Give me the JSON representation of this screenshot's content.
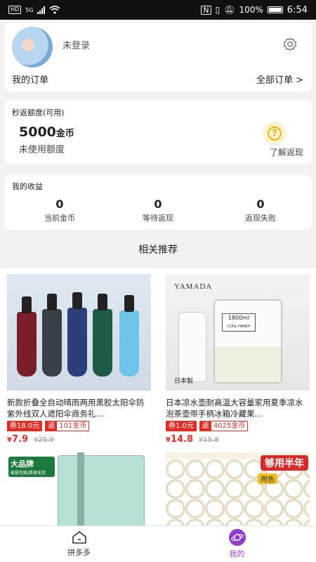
{
  "status_bar": {
    "network": "5G",
    "battery": "100%",
    "time": "6:54",
    "hd": "HD"
  },
  "profile": {
    "login_status": "未登录",
    "orders_label": "我的订单",
    "all_orders": "全部订单 >"
  },
  "quota": {
    "title": "秒返额度(可用)",
    "amount": "5000",
    "unit": "金币",
    "subtitle": "未使用额度",
    "help_label": "了解返现",
    "help_glyph": "?"
  },
  "earnings": {
    "title": "我的收益",
    "stats": [
      {
        "value": "0",
        "label": "当前金币"
      },
      {
        "value": "0",
        "label": "等待返现"
      },
      {
        "value": "0",
        "label": "返现失败"
      }
    ]
  },
  "recommend_title": "相关推荐",
  "products": [
    {
      "title": "新款折叠全自动晴雨两用黑胶太阳伞防紫外线双人遮阳伞商务礼…",
      "coupon": "券18.0元",
      "return_key": "返",
      "return_value": "101金币",
      "currency": "¥",
      "price": "7.9",
      "old_price": "¥25.9",
      "image": "umbrella-photo"
    },
    {
      "title": "日本凉水壶耐高温大容量家用夏季凉水泡茶壶带手柄冰箱冷藏果…",
      "coupon": "券1.0元",
      "return_key": "返",
      "return_value": "4025金币",
      "currency": "¥",
      "price": "14.8",
      "old_price": "¥15.8",
      "image": "water-jar-photo",
      "brand_text": "YAMADA",
      "jar_text": "1800ml",
      "jar_sub": "COOL HANDY",
      "made_in": "日本製"
    },
    {
      "image": "mop-bucket-photo",
      "badge": "大品牌",
      "badge_sub": "破损包赔/质保无忧"
    },
    {
      "image": "tissue-photo",
      "badge": "够用半年",
      "badge_sub": "用色"
    }
  ],
  "tabbar": {
    "home_label": "拼多多",
    "me_label": "我的"
  },
  "colors": {
    "accent_red": "#e02e24",
    "active_purple": "#9b3fc9",
    "help_yellow": "#f1b400"
  }
}
